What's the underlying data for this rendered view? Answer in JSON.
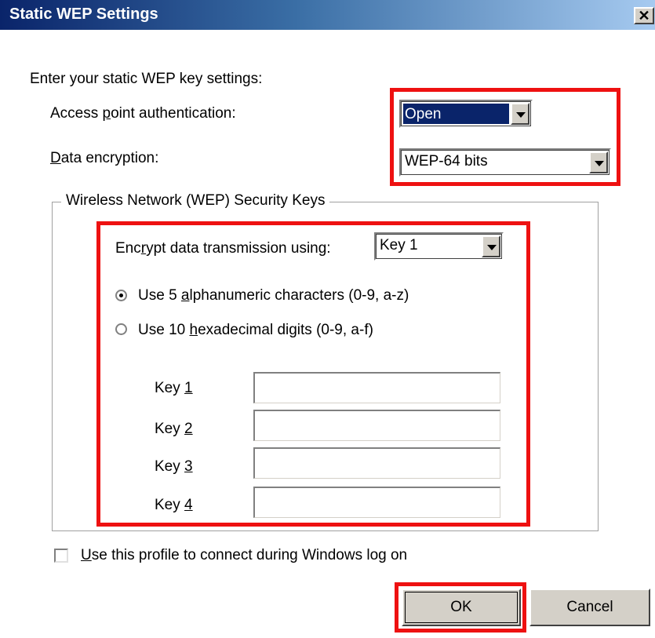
{
  "window": {
    "title": "Static WEP Settings",
    "close_glyph": "✕"
  },
  "intro": "Enter your static WEP key settings:",
  "auth": {
    "label_pre": "Access ",
    "label_u": "p",
    "label_post": "oint authentication:",
    "value": "Open"
  },
  "encryption": {
    "label_u": "D",
    "label_post": "ata encryption:",
    "value": "WEP-64 bits"
  },
  "group": {
    "legend": "Wireless Network (WEP) Security Keys",
    "encrypt_label_pre": "Enc",
    "encrypt_label_u": "r",
    "encrypt_label_post": "ypt data transmission using:",
    "encrypt_value": "Key 1",
    "radio1": {
      "pre": "Use 5 ",
      "u": "a",
      "post": "lphanumeric characters (0-9, a-z)",
      "checked": true
    },
    "radio2": {
      "pre": "Use 10 ",
      "u": "h",
      "post": "exadecimal digits (0-9, a-f)",
      "checked": false
    },
    "keys": [
      {
        "pre": "Key ",
        "u": "1",
        "value": ""
      },
      {
        "pre": "Key ",
        "u": "2",
        "value": ""
      },
      {
        "pre": "Key ",
        "u": "3",
        "value": ""
      },
      {
        "pre": "Key ",
        "u": "4",
        "value": ""
      }
    ]
  },
  "logon_checkbox": {
    "u": "U",
    "post": "se this profile to connect during Windows log on",
    "checked": false
  },
  "buttons": {
    "ok": "OK",
    "cancel": "Cancel"
  },
  "colors": {
    "highlight": "#ee1111",
    "selection": "#0a246a",
    "button_face": "#d4d0c8"
  }
}
